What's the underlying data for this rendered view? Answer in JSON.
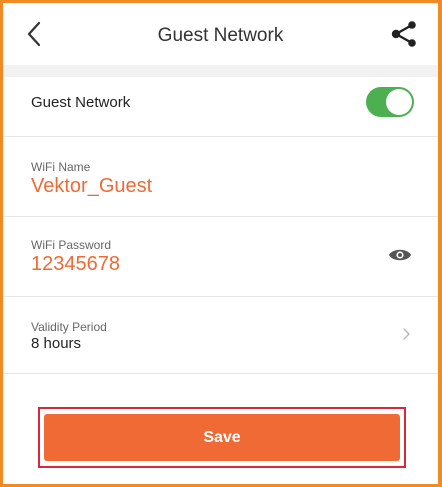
{
  "header": {
    "title": "Guest Network",
    "back_icon": "chevron-left-icon",
    "share_icon": "share-icon"
  },
  "guest_network": {
    "label": "Guest Network",
    "enabled": true,
    "toggle_color": "#4caf50"
  },
  "wifi_name": {
    "label": "WiFi Name",
    "value": "Vektor_Guest"
  },
  "wifi_password": {
    "label": "WiFi Password",
    "value": "12345678",
    "reveal_icon": "eye-icon"
  },
  "validity_period": {
    "label": "Validity Period",
    "value": "8 hours",
    "chevron_icon": "chevron-right-icon"
  },
  "save": {
    "label": "Save",
    "color": "#ef6a35"
  },
  "colors": {
    "accent": "#f06a35",
    "frame_border": "#f08a24",
    "highlight_border": "#d9283a"
  }
}
